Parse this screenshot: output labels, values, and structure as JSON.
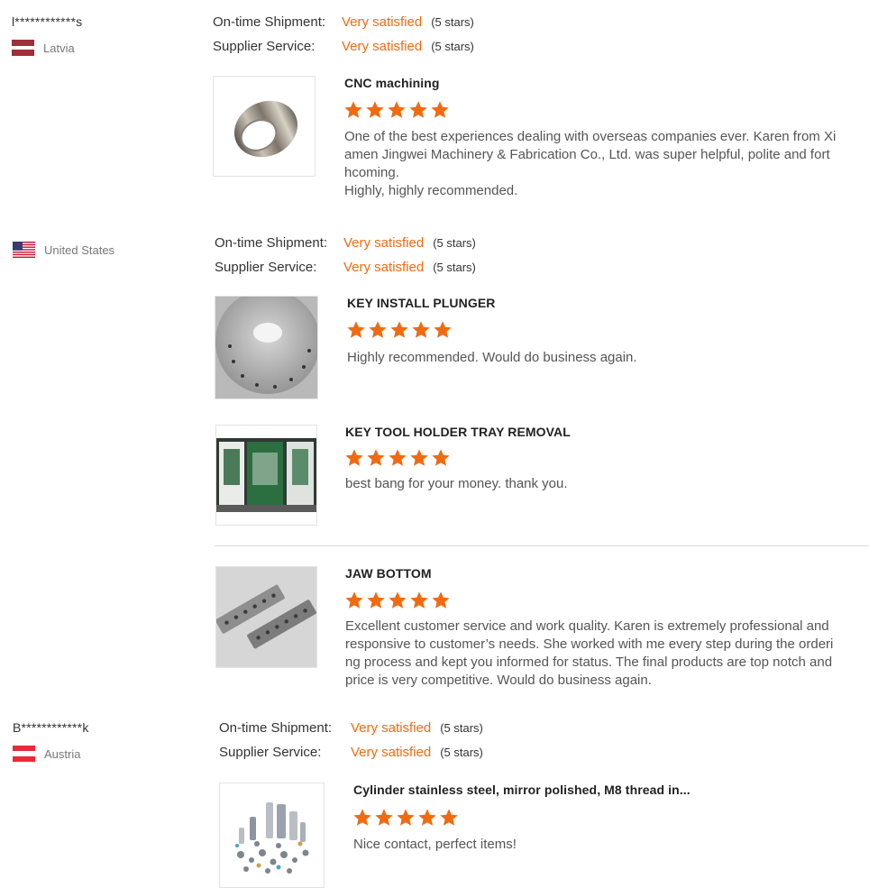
{
  "reviews": [
    {
      "user": "l************s",
      "country": "Latvia",
      "ontime_label": "On-time Shipment:",
      "ontime_value": "Very satisfied",
      "ontime_stars": "(5 stars)",
      "service_label": "Supplier Service:",
      "service_value": "Very satisfied",
      "service_stars": "(5 stars)",
      "products": [
        {
          "title": "CNC machining",
          "rating": 5,
          "text_lines": [
            "One of the best experiences dealing with overseas companies ever. Karen from Xi",
            "amen Jingwei Machinery & Fabrication Co., Ltd. was super helpful, polite and fort",
            "hcoming.",
            "Highly, highly recommended."
          ]
        }
      ]
    },
    {
      "user": "",
      "country": "United States",
      "ontime_label": "On-time Shipment:",
      "ontime_value": "Very satisfied",
      "ontime_stars": "(5 stars)",
      "service_label": "Supplier Service:",
      "service_value": "Very satisfied",
      "service_stars": "(5 stars)",
      "products": [
        {
          "title": "KEY INSTALL PLUNGER",
          "rating": 5,
          "text_lines": [
            "Highly recommended. Would do business again."
          ]
        },
        {
          "title": "KEY TOOL HOLDER TRAY REMOVAL",
          "rating": 5,
          "text_lines": [
            "best bang for your money. thank you."
          ]
        },
        {
          "title": "JAW BOTTOM",
          "rating": 5,
          "text_lines": [
            "Excellent customer service and work quality. Karen is extremely professional and",
            "responsive to customer’s needs. She worked with me every step during the orderi",
            "ng process and kept you informed for status. The final products are top notch and",
            "price is very competitive. Would do business again."
          ]
        }
      ]
    },
    {
      "user": "B************k",
      "country": "Austria",
      "ontime_label": "On-time Shipment:",
      "ontime_value": "Very satisfied",
      "ontime_stars": "(5 stars)",
      "service_label": "Supplier Service:",
      "service_value": "Very satisfied",
      "service_stars": "(5 stars)",
      "products": [
        {
          "title": "Cylinder stainless steel, mirror polished, M8 thread in...",
          "rating": 5,
          "text_lines": [
            "Nice contact, perfect items!"
          ]
        }
      ]
    }
  ],
  "colors": {
    "accent": "#f26a10",
    "star": "#f26a10"
  },
  "icons": [
    "latvia-flag-icon",
    "us-flag-icon",
    "austria-flag-icon",
    "star-icon"
  ]
}
